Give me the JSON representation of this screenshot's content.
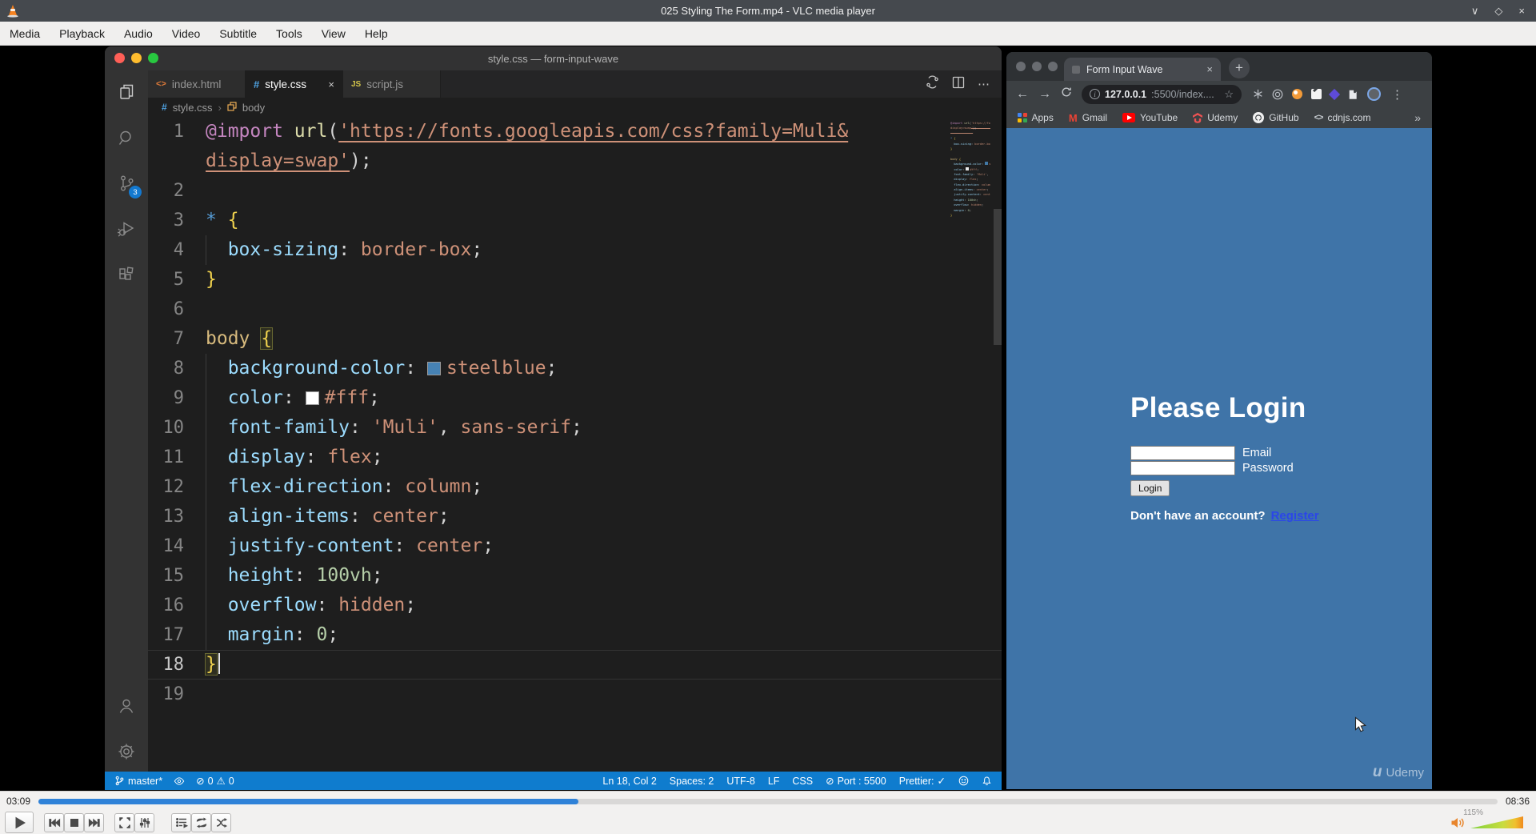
{
  "vlc": {
    "title": "025 Styling The Form.mp4 - VLC media player",
    "menu": [
      "Media",
      "Playback",
      "Audio",
      "Video",
      "Subtitle",
      "Tools",
      "View",
      "Help"
    ],
    "window_controls": {
      "minimize": "∨",
      "maximize": "◇",
      "close": "×"
    },
    "time_elapsed": "03:09",
    "time_total": "08:36",
    "progress_pct": 37,
    "volume_label": "115%"
  },
  "vscode": {
    "window_title": "style.css — form-input-wave",
    "tabs": [
      {
        "name": "index.html"
      },
      {
        "name": "style.css",
        "close": "×"
      },
      {
        "name": "script.js"
      }
    ],
    "breadcrumb": {
      "file": "style.css",
      "sep": "›",
      "symbol": "body"
    },
    "scm_badge": "3",
    "tab_actions_more": "⋯",
    "status": {
      "branch": "master*",
      "errors": "0",
      "warnings": "0",
      "error_glyph": "⊘",
      "warning_glyph": "⚠",
      "line_col": "Ln 18, Col 2",
      "spaces": "Spaces: 2",
      "encoding": "UTF-8",
      "eol": "LF",
      "language": "CSS",
      "port_glyph": "⊘",
      "port": "Port : 5500",
      "prettier": "Prettier:",
      "prettier_check": "✓"
    }
  },
  "code": {
    "rows": [
      {
        "n": "1",
        "seg": [
          [
            "kw",
            "@import"
          ],
          [
            "p",
            " "
          ],
          [
            "fn",
            "url"
          ],
          [
            "p",
            "("
          ],
          [
            "su",
            "'https://fonts.googleapis.com/css?family=Muli&"
          ]
        ]
      },
      {
        "n": "",
        "seg": [
          [
            "su",
            "display=swap'"
          ],
          [
            "p",
            ");"
          ]
        ]
      },
      {
        "n": "2",
        "seg": []
      },
      {
        "n": "3",
        "seg": [
          [
            "ss",
            "*"
          ],
          [
            "p",
            " "
          ],
          [
            "br",
            "{"
          ]
        ]
      },
      {
        "n": "4",
        "g": 1,
        "seg": [
          [
            "p",
            "  "
          ],
          [
            "pr",
            "box-sizing"
          ],
          [
            "p",
            ": "
          ],
          [
            "s",
            "border-box"
          ],
          [
            "p",
            ";"
          ]
        ]
      },
      {
        "n": "5",
        "seg": [
          [
            "br",
            "}"
          ]
        ]
      },
      {
        "n": "6",
        "seg": []
      },
      {
        "n": "7",
        "seg": [
          [
            "sel",
            "body"
          ],
          [
            "p",
            " "
          ],
          [
            "brm",
            "{"
          ]
        ]
      },
      {
        "n": "8",
        "g": 1,
        "seg": [
          [
            "p",
            "  "
          ],
          [
            "pr",
            "background-color"
          ],
          [
            "p",
            ": "
          ],
          [
            "sw",
            "#4682b4"
          ],
          [
            "s",
            "steelblue"
          ],
          [
            "p",
            ";"
          ]
        ]
      },
      {
        "n": "9",
        "g": 1,
        "seg": [
          [
            "p",
            "  "
          ],
          [
            "pr",
            "color"
          ],
          [
            "p",
            ": "
          ],
          [
            "sw",
            "#ffffff"
          ],
          [
            "s",
            "#fff"
          ],
          [
            "p",
            ";"
          ]
        ]
      },
      {
        "n": "10",
        "g": 1,
        "seg": [
          [
            "p",
            "  "
          ],
          [
            "pr",
            "font-family"
          ],
          [
            "p",
            ": "
          ],
          [
            "s",
            "'Muli'"
          ],
          [
            "p",
            ", "
          ],
          [
            "s",
            "sans-serif"
          ],
          [
            "p",
            ";"
          ]
        ]
      },
      {
        "n": "11",
        "g": 1,
        "seg": [
          [
            "p",
            "  "
          ],
          [
            "pr",
            "display"
          ],
          [
            "p",
            ": "
          ],
          [
            "s",
            "flex"
          ],
          [
            "p",
            ";"
          ]
        ]
      },
      {
        "n": "12",
        "g": 1,
        "seg": [
          [
            "p",
            "  "
          ],
          [
            "pr",
            "flex-direction"
          ],
          [
            "p",
            ": "
          ],
          [
            "s",
            "column"
          ],
          [
            "p",
            ";"
          ]
        ]
      },
      {
        "n": "13",
        "g": 1,
        "seg": [
          [
            "p",
            "  "
          ],
          [
            "pr",
            "align-items"
          ],
          [
            "p",
            ": "
          ],
          [
            "s",
            "center"
          ],
          [
            "p",
            ";"
          ]
        ]
      },
      {
        "n": "14",
        "g": 1,
        "seg": [
          [
            "p",
            "  "
          ],
          [
            "pr",
            "justify-content"
          ],
          [
            "p",
            ": "
          ],
          [
            "s",
            "center"
          ],
          [
            "p",
            ";"
          ]
        ]
      },
      {
        "n": "15",
        "g": 1,
        "seg": [
          [
            "p",
            "  "
          ],
          [
            "pr",
            "height"
          ],
          [
            "p",
            ": "
          ],
          [
            "nu",
            "100vh"
          ],
          [
            "p",
            ";"
          ]
        ]
      },
      {
        "n": "16",
        "g": 1,
        "seg": [
          [
            "p",
            "  "
          ],
          [
            "pr",
            "overflow"
          ],
          [
            "p",
            ": "
          ],
          [
            "s",
            "hidden"
          ],
          [
            "p",
            ";"
          ]
        ]
      },
      {
        "n": "17",
        "g": 1,
        "seg": [
          [
            "p",
            "  "
          ],
          [
            "pr",
            "margin"
          ],
          [
            "p",
            ": "
          ],
          [
            "nu",
            "0"
          ],
          [
            "p",
            ";"
          ]
        ]
      },
      {
        "n": "18",
        "cur": 1,
        "seg": [
          [
            "brm",
            "}"
          ],
          [
            "caret",
            ""
          ]
        ]
      },
      {
        "n": "19",
        "seg": []
      }
    ]
  },
  "browser": {
    "tab_title": "Form Input Wave",
    "tab_close": "×",
    "new_tab": "+",
    "nav": {
      "back": "←",
      "forward": "→"
    },
    "url": {
      "host": "127.0.0.1",
      "rest": ":5500/index....",
      "star": "☆"
    },
    "menu_dots": "⋮",
    "bookmarks": {
      "apps": "Apps",
      "gmail": "Gmail",
      "youtube": "YouTube",
      "udemy": "Udemy",
      "github": "GitHub",
      "cdnjs": "cdnjs.com",
      "overflow": "»"
    },
    "page": {
      "heading": "Please Login",
      "email_label": "Email",
      "password_label": "Password",
      "login_button": "Login",
      "register_question": "Don't have an account?",
      "register_link": "Register",
      "watermark": "Udemy",
      "bg_color": "#3f74a8"
    }
  },
  "colors": {
    "page_steelblue": "#3f74a8",
    "statusbar_blue": "#0f7cce",
    "seek_fill_blue": "#2f82d8",
    "vlc_orange": "#f58220"
  }
}
